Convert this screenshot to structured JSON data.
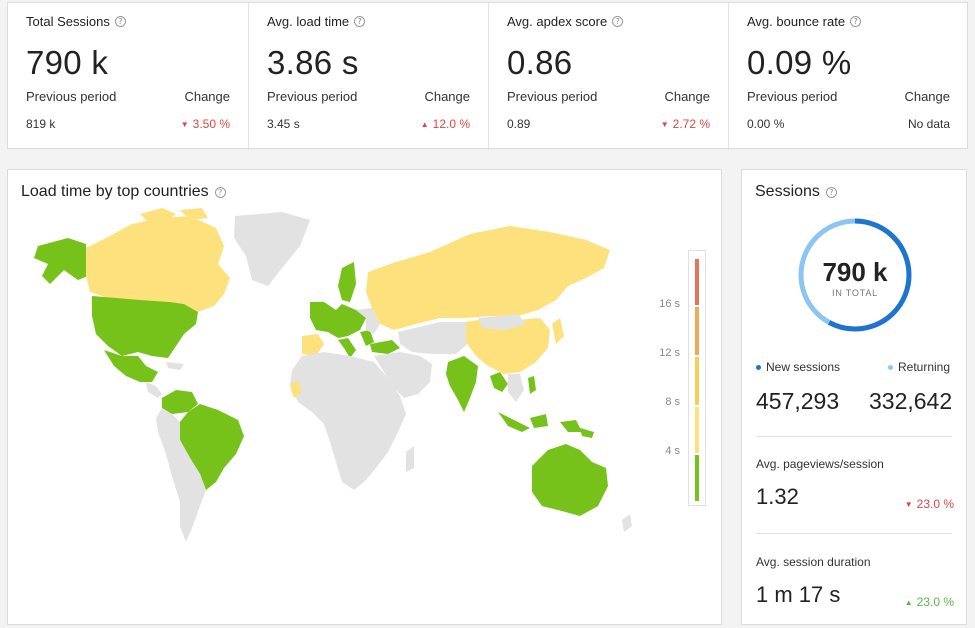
{
  "kpis": [
    {
      "title": "Total Sessions",
      "value": "790 k",
      "prev_label": "Previous period",
      "change_label": "Change",
      "prev_value": "819 k",
      "change_value": "3.50 %",
      "direction": "down"
    },
    {
      "title": "Avg. load time",
      "value": "3.86 s",
      "prev_label": "Previous period",
      "change_label": "Change",
      "prev_value": "3.45 s",
      "change_value": "12.0 %",
      "direction": "up"
    },
    {
      "title": "Avg. apdex score",
      "value": "0.86",
      "prev_label": "Previous period",
      "change_label": "Change",
      "prev_value": "0.89",
      "change_value": "2.72 %",
      "direction": "down"
    },
    {
      "title": "Avg. bounce rate",
      "value": "0.09 %",
      "prev_label": "Previous period",
      "change_label": "Change",
      "prev_value": "0.00 %",
      "change_value": "No data",
      "direction": "none"
    }
  ],
  "map": {
    "title": "Load time by top countries",
    "legend_ticks": [
      "16 s",
      "12 s",
      "8 s",
      "4 s"
    ],
    "colors": {
      "good": "#77c11b",
      "mid": "#fde17d",
      "none": "#e2e2e2",
      "legend": [
        "#e8735c",
        "#f0a955",
        "#f7cf57",
        "#fde17d",
        "#77c11b"
      ]
    }
  },
  "sessions": {
    "title": "Sessions",
    "total": "790 k",
    "total_sub": "IN TOTAL",
    "new_label": "New sessions",
    "returning_label": "Returning",
    "new_value": "457,293",
    "returning_value": "332,642",
    "new_share": 0.579,
    "new_color": "#1f74d0",
    "returning_color": "#8cc5f2",
    "pageviews_title": "Avg. pageviews/session",
    "pageviews_value": "1.32",
    "pageviews_change": "23.0 %",
    "duration_title": "Avg. session duration",
    "duration_value": "1 m 17 s",
    "duration_change": "23.0 %"
  }
}
